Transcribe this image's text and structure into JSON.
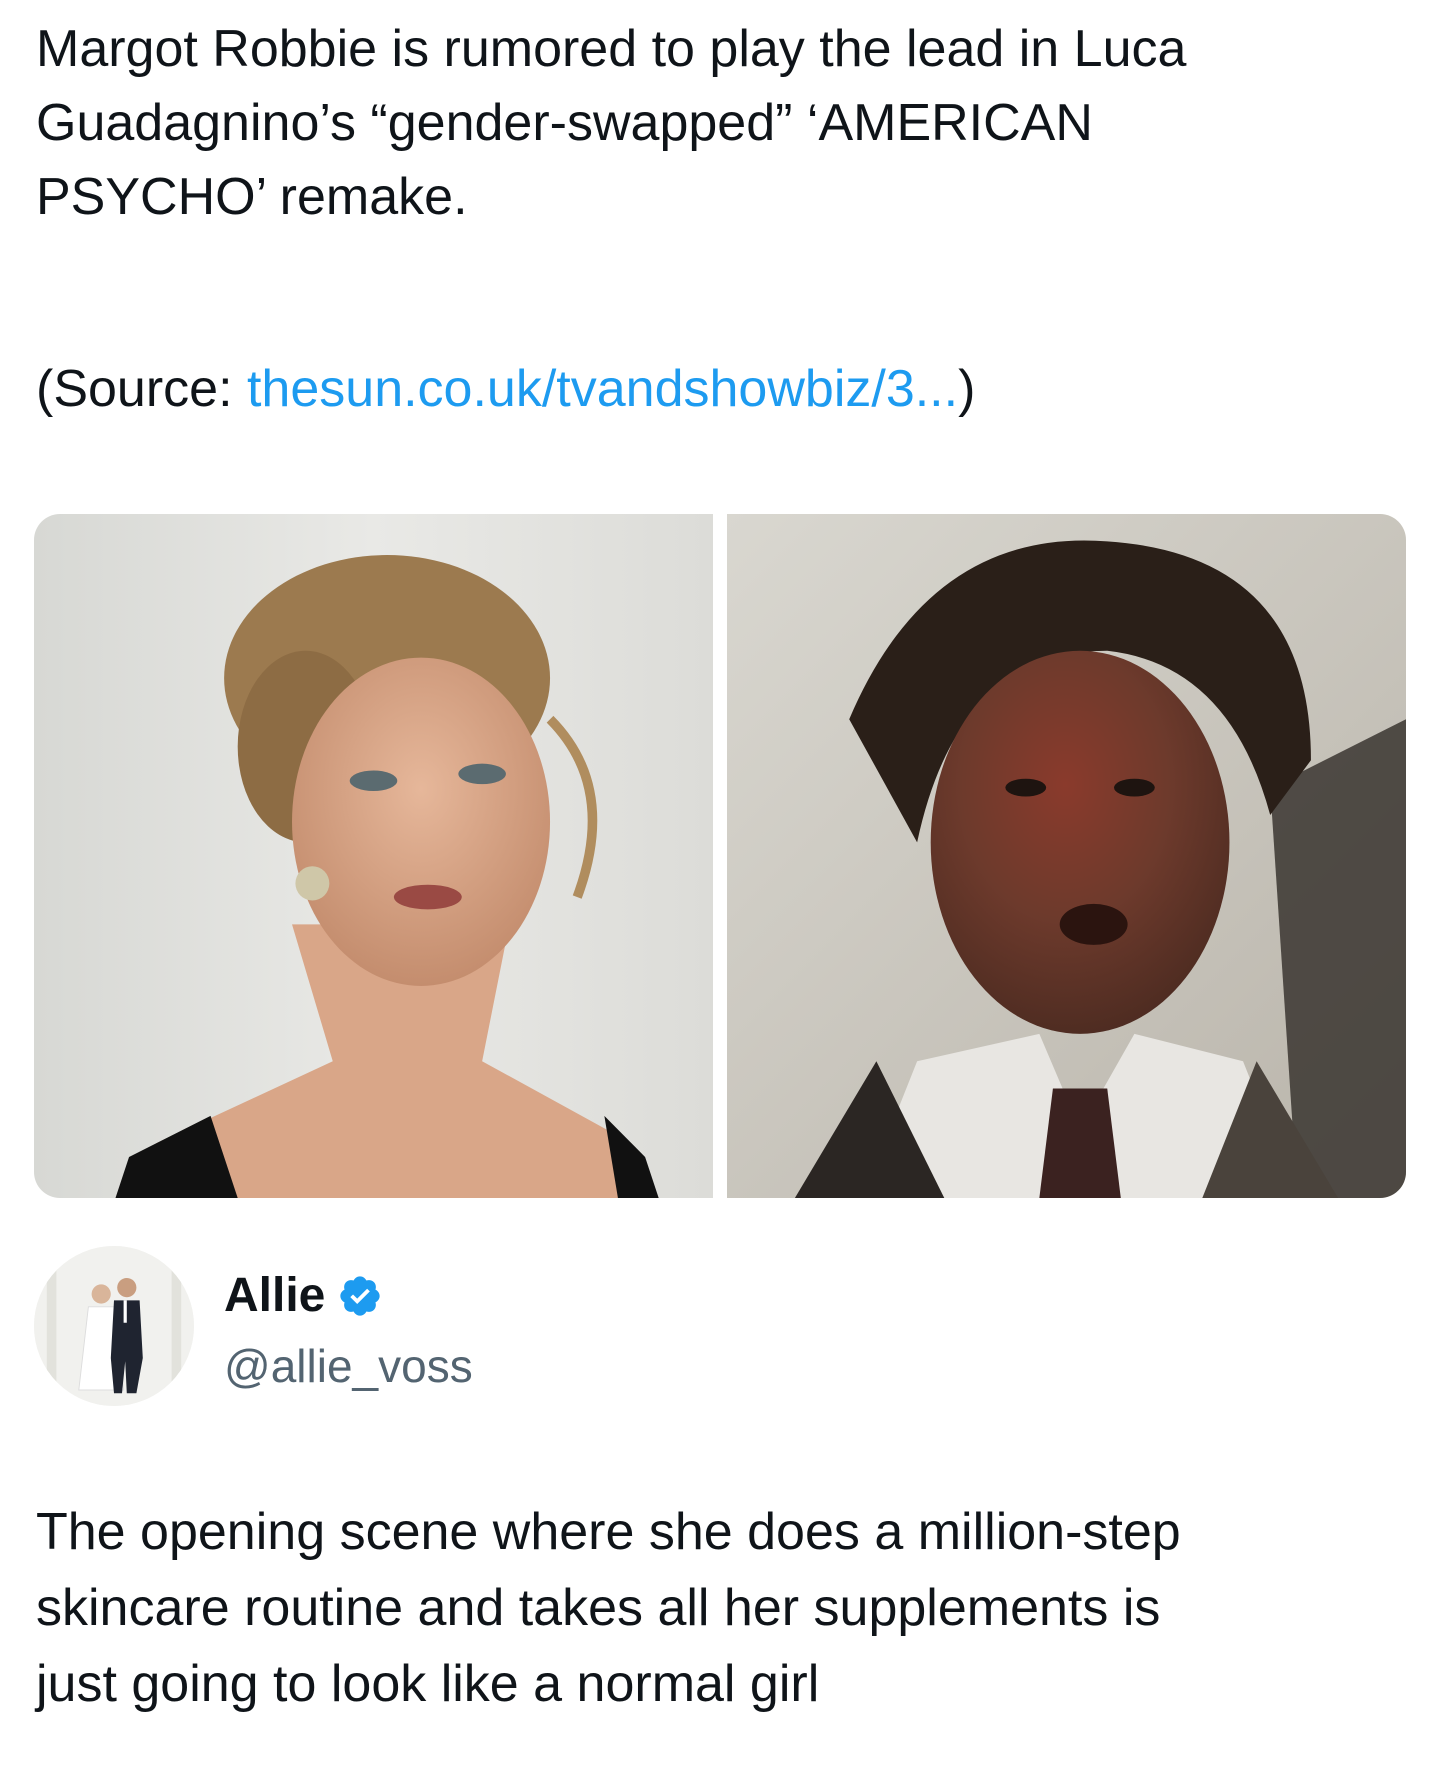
{
  "quoted_tweet": {
    "text": "Margot Robbie is rumored to play the lead in Luca\nGuadagnino’s “gender-swapped” ‘AMERICAN\nPSYCHO’ remake.",
    "source_prefix": "(Source: ",
    "source_link": "thesun.co.uk/tvandshowbiz/3...",
    "source_suffix": ")",
    "media": [
      {
        "icon": "photo-woman-portrait"
      },
      {
        "icon": "photo-man-bloodied-face"
      }
    ]
  },
  "author": {
    "name": "Allie",
    "handle": "@allie_voss",
    "verified": true,
    "verified_color": "#1d9bf0",
    "avatar_icon": "wedding-couple-avatar"
  },
  "reply": {
    "text": "The opening scene where she does a million-step\nskincare routine and takes all her supplements is\njust going to look like a normal girl"
  },
  "colors": {
    "link": "#1d9bf0",
    "text": "#0f1419",
    "secondary": "#536471"
  }
}
